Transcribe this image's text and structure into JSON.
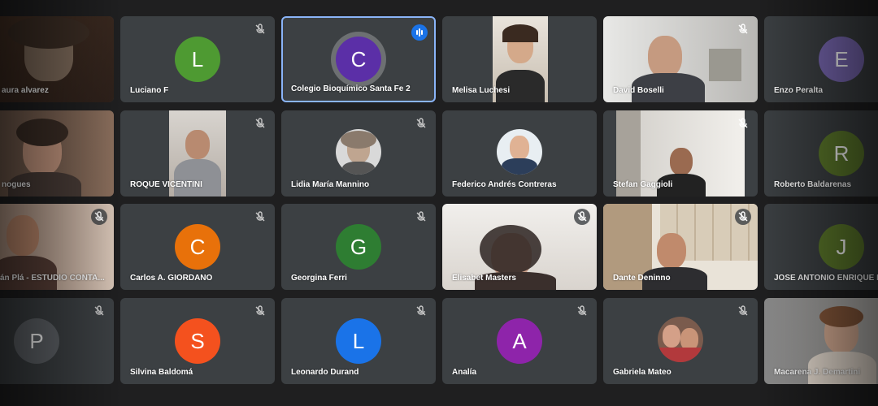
{
  "participants": [
    {
      "name": "aura alvarez",
      "kind": "video"
    },
    {
      "name": "Luciano F",
      "initial": "L",
      "color": "#4e9a32"
    },
    {
      "name": "Colegio Bioquímico Santa Fe 2",
      "initial": "C",
      "color": "#5b2fa7",
      "speaking": true
    },
    {
      "name": "Melisa Luchesi",
      "kind": "video"
    },
    {
      "name": "David Boselli",
      "kind": "video"
    },
    {
      "name": "Enzo Peralta",
      "initial": "E",
      "color": "#7a69b4"
    },
    {
      "name": "nogues",
      "kind": "video"
    },
    {
      "name": "ROQUE VICENTINI",
      "kind": "video"
    },
    {
      "name": "Lidia María Mannino",
      "kind": "photo"
    },
    {
      "name": "Federico Andrés Contreras",
      "kind": "photo"
    },
    {
      "name": "Stefan Gaggioli",
      "kind": "video"
    },
    {
      "name": "Roberto Baldarenas",
      "initial": "R",
      "color": "#5d7a2b"
    },
    {
      "name": "án Plá - ESTUDIO CONTA...",
      "kind": "video"
    },
    {
      "name": "Carlos A. GIORDANO",
      "initial": "C",
      "color": "#e8710a"
    },
    {
      "name": "Georgina Ferri",
      "initial": "G",
      "color": "#2e7d32"
    },
    {
      "name": "Elisabet Masters",
      "kind": "video"
    },
    {
      "name": "Dante Deninno",
      "kind": "video"
    },
    {
      "name": "JOSE ANTONIO ENRIQUE E",
      "initial": "J",
      "color": "#5d7a2b"
    },
    {
      "name": "",
      "initial": "P",
      "color": "#5f6368"
    },
    {
      "name": "Silvina Baldomá",
      "initial": "S",
      "color": "#f4511e"
    },
    {
      "name": "Leonardo Durand",
      "initial": "L",
      "color": "#1a73e8"
    },
    {
      "name": "Analía",
      "initial": "A",
      "color": "#8e24aa"
    },
    {
      "name": "Gabriela Mateo",
      "kind": "photo"
    },
    {
      "name": "Macarena J. Demartini",
      "kind": "video"
    }
  ]
}
